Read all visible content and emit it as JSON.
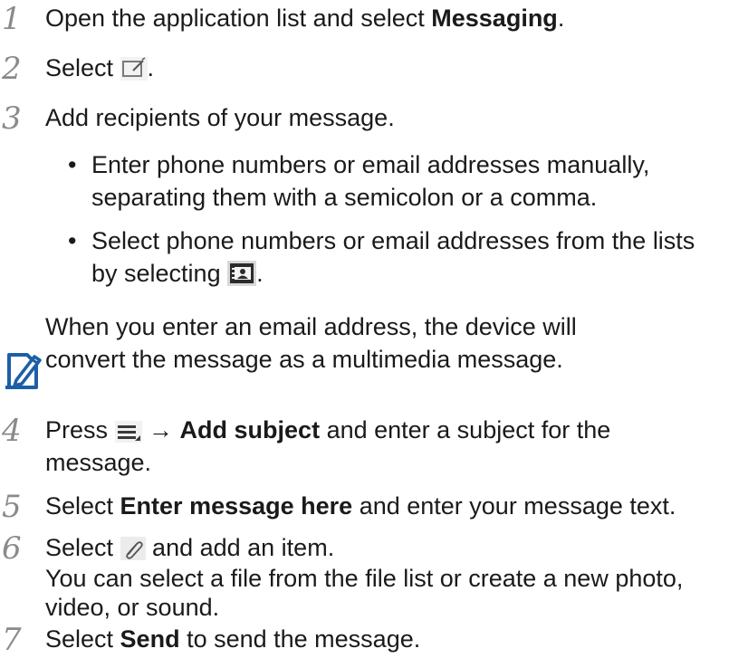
{
  "steps": [
    {
      "num": "1",
      "pre": "Open the application list and select ",
      "bold": "Messaging",
      "post": "."
    },
    {
      "num": "2",
      "pre": "Select ",
      "post": "."
    },
    {
      "num": "3",
      "text": "Add recipients of your message."
    },
    {
      "num": "4",
      "pre": "Press ",
      "arrow": " → ",
      "bold": "Add subject",
      "post": " and enter a subject for the",
      "line2": "message."
    },
    {
      "num": "5",
      "pre": "Select ",
      "bold": "Enter message here",
      "post": " and enter your message text."
    },
    {
      "num": "6",
      "pre": "Select ",
      "post": " and add an item.",
      "line2": "You can select a file from the file list or create a new photo,",
      "line3": "video, or sound."
    },
    {
      "num": "7",
      "pre": "Select ",
      "bold": "Send",
      "post": " to send the message."
    }
  ],
  "bullets": [
    {
      "line1": "Enter phone numbers or email addresses manually,",
      "line2": "separating them with a semicolon or a comma."
    },
    {
      "line1": "Select phone numbers or email addresses from the lists",
      "line2_pre": "by selecting ",
      "line2_post": "."
    }
  ],
  "bullet_glyph": "•",
  "note": {
    "line1": "When you enter an email address, the device will",
    "line2": "convert the message as a multimedia message."
  },
  "icons": {
    "compose": "compose-icon",
    "contacts": "contacts-icon",
    "menu": "menu-key-icon",
    "attach": "attach-icon",
    "note": "note-pencil-icon",
    "accent": "#1c5fa6"
  }
}
